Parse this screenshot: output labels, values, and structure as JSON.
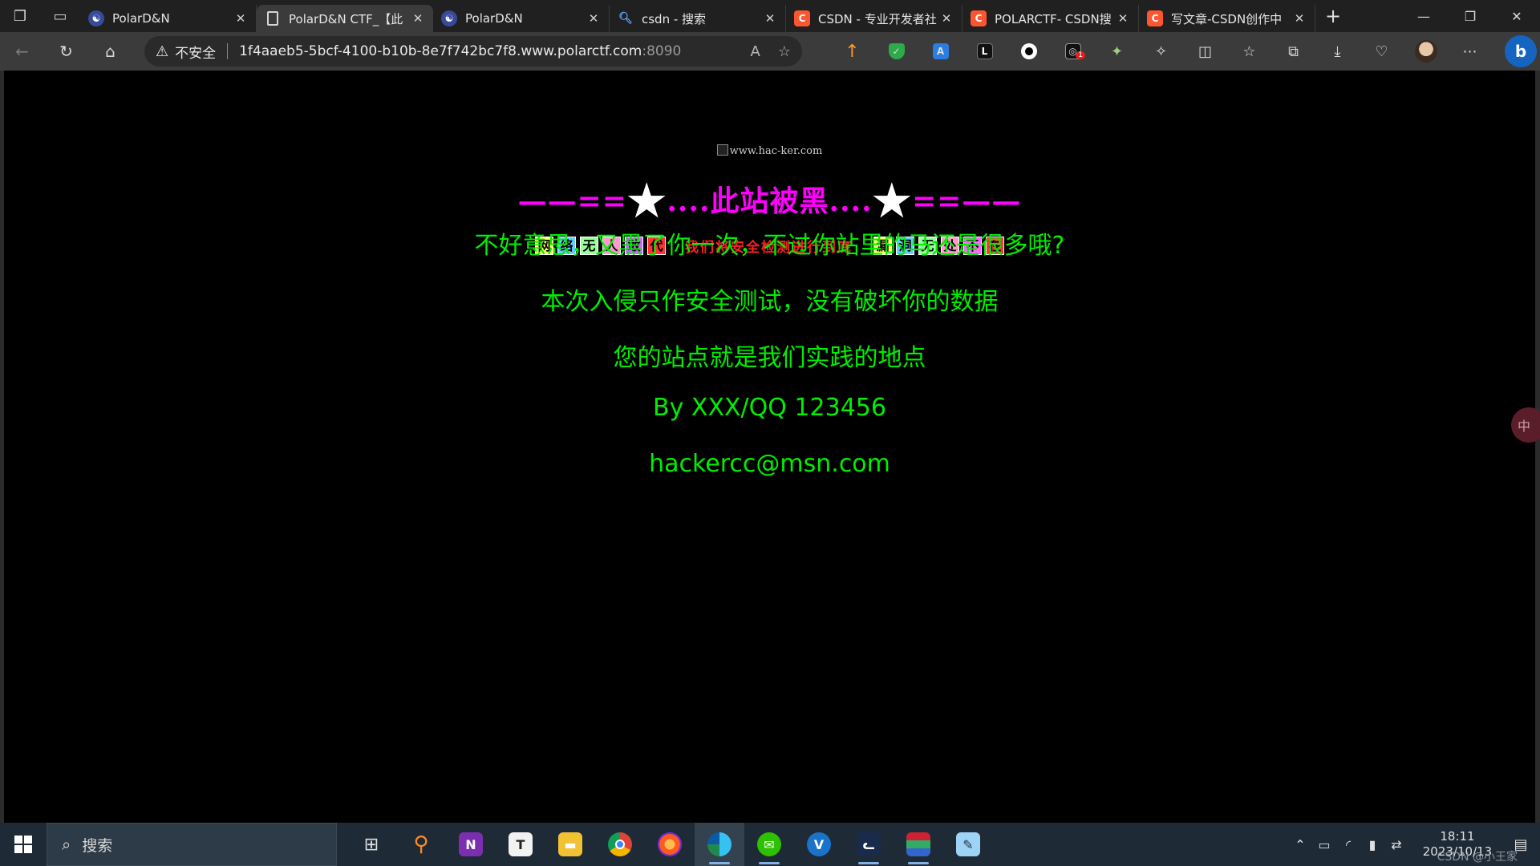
{
  "tabs": [
    {
      "title": "PolarD&N",
      "favicon": "polar-logo-icon"
    },
    {
      "title": "PolarD&N CTF_【此",
      "favicon": "document-icon",
      "active": true
    },
    {
      "title": "PolarD&N",
      "favicon": "polar-logo-icon"
    },
    {
      "title": "csdn - 搜索",
      "favicon": "search-icon"
    },
    {
      "title": "CSDN - 专业开发者社",
      "favicon": "csdn-icon"
    },
    {
      "title": "POLARCTF- CSDN搜",
      "favicon": "csdn-icon"
    },
    {
      "title": "写文章-CSDN创作中",
      "favicon": "csdn-icon"
    }
  ],
  "address": {
    "security_label": "不安全",
    "url_host": "1f4aaeb5-5bcf-4100-b10b-8e7f742bc7f8.www.polarctf.com",
    "url_port": ":8090"
  },
  "toolbar": {
    "extension_badge": "1"
  },
  "page": {
    "broken_image_alt": "www.hac-ker.com",
    "banner_left": "——==",
    "banner_text": "....此站被黑....",
    "banner_right": "==——",
    "left_boxes": [
      "网",
      "络",
      "无",
      "人",
      "敢",
      "代"
    ],
    "left_box_colors": [
      "#ffff66",
      "#66ccff",
      "#99ff99",
      "#ff99cc",
      "#cc66ff",
      "#ff3333"
    ],
    "middle_text": "我们将安全检测进行到底",
    "right_boxes": [
      "漏",
      "洞",
      "无",
      "处",
      "不",
      "在"
    ],
    "right_box_colors": [
      "#ffff66",
      "#66ccff",
      "#99ff99",
      "#ff99cc",
      "#ff66ff",
      "#ff3333"
    ],
    "lines": [
      "不好意思，又黑了你一次，不过你站里的马还是很多哦?",
      "本次入侵只作安全测试，没有破坏你的数据",
      "您的站点就是我们实践的地点",
      "By XXX/QQ 123456",
      "hackercc@msn.com"
    ],
    "side_widget_text": "中"
  },
  "taskbar": {
    "search_placeholder": "搜索",
    "time": "18:11",
    "date": "2023/10/13",
    "watermark": "CSDN @小王家"
  },
  "colors": {
    "banner": "#ff00ff",
    "message": "#00ee00",
    "middle_text": "#ff2020",
    "page_bg": "#000000"
  }
}
